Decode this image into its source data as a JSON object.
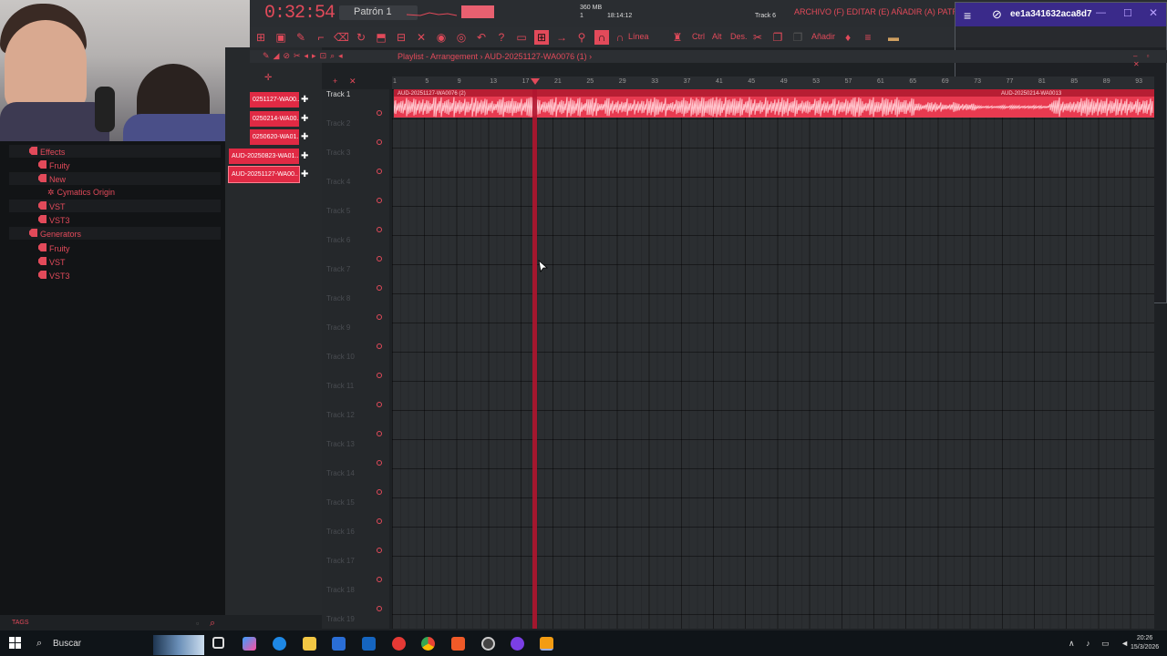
{
  "transport": {
    "time": "0:32:54",
    "pattern": "Patrón 1",
    "cpu_mem": "360 MB",
    "cpu_num": "1",
    "clock": "18:14:12",
    "hint_track": "Track 6"
  },
  "menu": {
    "text": "ARCHIVO (F) EDITAR (E) AÑADIR (A) PATRONES (P) V"
  },
  "toolbar": {
    "linea": "Línea",
    "ctrl": "Ctrl",
    "alt": "Alt",
    "des": "Des.",
    "anadir": "Añadir"
  },
  "overlay": {
    "title": "ee1a341632aca8d7"
  },
  "browser": {
    "items": [
      {
        "label": "Effects"
      },
      {
        "label": "Fruity"
      },
      {
        "label": "New"
      },
      {
        "label": "Cymatics Origin"
      },
      {
        "label": "VST"
      },
      {
        "label": "VST3"
      },
      {
        "label": "Generators"
      },
      {
        "label": "Fruity"
      },
      {
        "label": "VST"
      },
      {
        "label": "VST3"
      }
    ],
    "tags": "TAGS"
  },
  "picker": {
    "clips": [
      "0251127-WA00..",
      "0250214-WA00..",
      "0250620-WA01..",
      "AUD-20250823-WA01..",
      "AUD-20251127-WA00.."
    ]
  },
  "playlist": {
    "title": "Playlist - Arrangement › AUD-20251127-WA0076 (1) ›",
    "clip1_label": "AUD-20251127-WA0076 (2)",
    "clip2_label": "AUD-20250214-WA0013",
    "ticks": [
      "1",
      "5",
      "9",
      "13",
      "17",
      "21",
      "25",
      "29",
      "33",
      "37",
      "41",
      "45",
      "49",
      "53",
      "57",
      "61",
      "65",
      "69",
      "73",
      "77",
      "81",
      "85",
      "89",
      "93"
    ],
    "tracks": [
      "Track 1",
      "Track 2",
      "Track 3",
      "Track 4",
      "Track 5",
      "Track 6",
      "Track 7",
      "Track 8",
      "Track 9",
      "Track 10",
      "Track 11",
      "Track 12",
      "Track 13",
      "Track 14",
      "Track 15",
      "Track 16",
      "Track 17",
      "Track 18",
      "Track 19"
    ]
  },
  "taskbar": {
    "search": "Buscar",
    "time": "20:26",
    "date": "15/3/2026"
  },
  "colors": {
    "accent": "#e24a5a",
    "clip": "#e83a50"
  }
}
